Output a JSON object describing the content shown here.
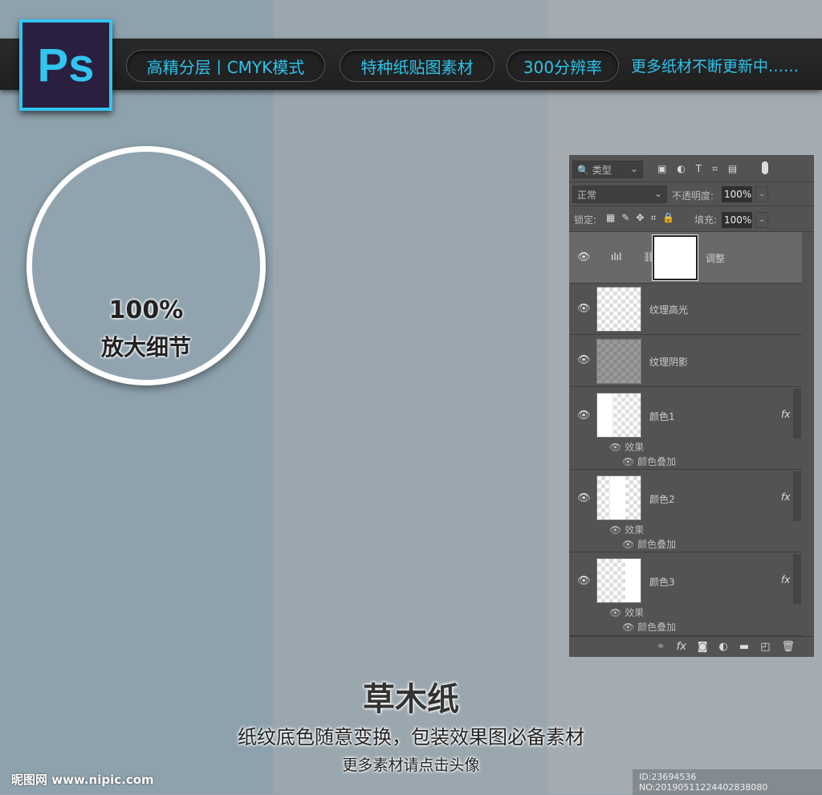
{
  "banner": {
    "logo": "Ps",
    "pills": [
      "高精分层丨CMYK模式",
      "特种纸贴图素材",
      "300分辨率"
    ],
    "tagline": "更多纸材不断更新中……",
    "accent": "#2ec3ea"
  },
  "zoom_circle": {
    "percent": "100%",
    "label": "放大细节"
  },
  "panel": {
    "filter": "类型",
    "blend_mode": "正常",
    "opacity_label": "不透明度:",
    "opacity": "100%",
    "lock_label": "锁定:",
    "fill_label": "填充:",
    "fill": "100%",
    "layers": [
      {
        "name": "调整"
      },
      {
        "name": "纹理高光"
      },
      {
        "name": "纹理阴影"
      },
      {
        "name": "颜色1",
        "fx": "fx",
        "effects": "效果",
        "effect": "颜色叠加"
      },
      {
        "name": "颜色2",
        "fx": "fx",
        "effects": "效果",
        "effect": "颜色叠加"
      },
      {
        "name": "颜色3",
        "fx": "fx",
        "effects": "效果",
        "effect": "颜色叠加"
      }
    ]
  },
  "footer": {
    "title": "草木纸",
    "subtitle": "纸纹底色随意变换，包装效果图必备素材",
    "note": "更多素材请点击头像",
    "watermark": "昵图网 www.nipic.com",
    "id": "ID:23694536 NO:20190511224402838080"
  }
}
